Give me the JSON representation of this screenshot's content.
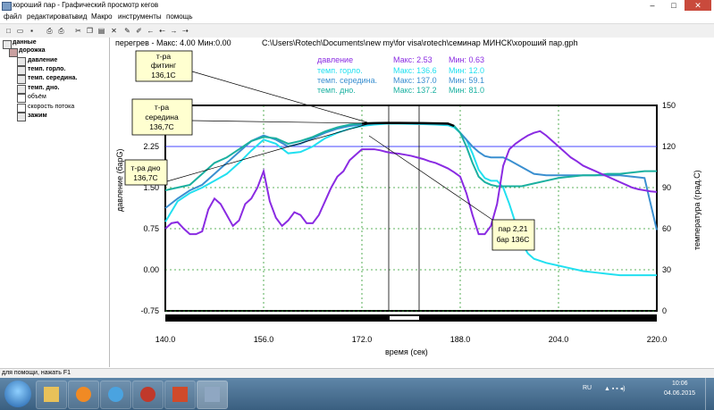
{
  "window": {
    "title": "хороший пар - Графический просмотр кегов",
    "min": "–",
    "max": "□",
    "close": "✕"
  },
  "menu": [
    "файл",
    "редактировать",
    "вид",
    "Макро",
    "инструменты",
    "помощь"
  ],
  "toolbar_icons": [
    "new-icon",
    "open-icon",
    "save-icon",
    "print-preview-icon",
    "print-icon",
    "cut-icon",
    "copy-icon",
    "paste-icon",
    "delete-icon",
    "edit-icon",
    "pen-icon",
    "arrow-left-icon",
    "arrow-left2-icon",
    "arrow-right-icon",
    "arrow-right2-icon"
  ],
  "tree": {
    "root": "данные",
    "track": "дорожка",
    "items": [
      "давление",
      "темп. горло.",
      "темп. середина.",
      "темп. дно.",
      "объём",
      "скорость потока",
      "зажим"
    ]
  },
  "chart_header": {
    "overheat": "перегрев - Макс: 4.00  Мин:0.00",
    "path": "C:\\Users\\Rotech\\Documents\\new my\\for visa\\rotech\\семинар МИНСК\\хороший пар.gph"
  },
  "stats": [
    {
      "name": "давление",
      "max": "Макс: 2.53",
      "min": "Мин: 0.63",
      "color": "#8a2be2"
    },
    {
      "name": "темп. горло.",
      "max": "Макс: 136.6",
      "min": "Мин: 12.0",
      "color": "#22e0f0"
    },
    {
      "name": "темп. середина.",
      "max": "Макс: 137.0",
      "min": "Мин: 59.1",
      "color": "#3a8fd0"
    },
    {
      "name": "темп. дно.",
      "max": "Макс: 137.2",
      "min": "Мин: 81.0",
      "color": "#1ab0a0"
    }
  ],
  "annotations": [
    {
      "lines": [
        "т-ра",
        "фитинг",
        "136,1С"
      ]
    },
    {
      "lines": [
        "т-ра",
        "середина",
        "136,7С"
      ]
    },
    {
      "lines": [
        "т-ра дно",
        "136,7С"
      ]
    },
    {
      "lines": [
        "пар 2,21",
        "бар 136С"
      ]
    }
  ],
  "chart_data": {
    "type": "line",
    "xlabel": "время (сек)",
    "ylabel": "давление (барG)",
    "y2label": "температура (град.C)",
    "xlim": [
      140,
      220
    ],
    "ylim": [
      -0.75,
      3.0
    ],
    "y2lim": [
      0,
      150
    ],
    "xticks": [
      "140.0",
      "156.0",
      "172.0",
      "188.0",
      "204.0",
      "220.0"
    ],
    "yticks": [
      "-0.75",
      "0.00",
      "0.75",
      "1.50",
      "2.25"
    ],
    "y2ticks": [
      "0",
      "30",
      "60",
      "90",
      "120",
      "150"
    ],
    "hline": 2.25,
    "series": [
      {
        "name": "давление",
        "color": "#8a2be2",
        "axis": "left",
        "x": [
          140,
          141,
          142,
          143,
          144,
          145,
          146,
          147,
          148,
          149,
          150,
          151,
          152,
          153,
          154,
          155,
          156,
          157,
          158,
          159,
          160,
          161,
          162,
          163,
          164,
          165,
          166,
          167,
          168,
          169,
          170,
          171,
          172,
          173,
          174,
          175,
          176,
          177,
          178,
          179,
          180,
          181,
          182,
          183,
          184,
          185,
          186,
          187,
          188,
          189,
          190,
          191,
          192,
          193,
          194,
          195,
          196,
          197,
          198,
          199,
          200,
          201,
          202,
          203,
          204,
          205,
          206,
          207,
          208,
          209,
          210,
          211,
          212,
          213,
          214,
          215,
          216,
          217,
          218,
          219,
          220
        ],
        "y": [
          0.75,
          0.85,
          0.87,
          0.75,
          0.65,
          0.65,
          0.7,
          1.1,
          1.3,
          1.2,
          1.0,
          0.8,
          0.9,
          1.2,
          1.3,
          1.5,
          1.8,
          1.25,
          0.95,
          0.8,
          0.9,
          1.05,
          1.0,
          0.85,
          0.85,
          1.0,
          1.25,
          1.5,
          1.7,
          1.8,
          2.0,
          2.1,
          2.2,
          2.2,
          2.2,
          2.18,
          2.15,
          2.13,
          2.12,
          2.1,
          2.08,
          2.05,
          2.02,
          1.98,
          1.95,
          1.9,
          1.85,
          1.78,
          1.7,
          1.4,
          1.0,
          0.65,
          0.65,
          0.8,
          1.2,
          1.9,
          2.2,
          2.3,
          2.38,
          2.45,
          2.5,
          2.53,
          2.45,
          2.35,
          2.25,
          2.15,
          2.05,
          1.98,
          1.9,
          1.85,
          1.8,
          1.75,
          1.7,
          1.65,
          1.6,
          1.55,
          1.5,
          1.47,
          1.45,
          1.43,
          1.42
        ]
      },
      {
        "name": "темп. горло.",
        "color": "#22e0f0",
        "axis": "right",
        "x": [
          140,
          142,
          144,
          146,
          148,
          150,
          152,
          154,
          156,
          158,
          160,
          162,
          164,
          166,
          168,
          170,
          172,
          174,
          176,
          178,
          180,
          182,
          184,
          186,
          187,
          188,
          189,
          190,
          191,
          192,
          193,
          194,
          195,
          196,
          197,
          198,
          199,
          200,
          202,
          204,
          206,
          208,
          210,
          212,
          214,
          216,
          218,
          220
        ],
        "y": [
          65,
          80,
          86,
          90,
          95,
          100,
          108,
          117,
          125,
          122,
          115,
          116,
          120,
          126,
          130,
          133,
          135,
          136,
          136.6,
          136.6,
          136.5,
          136.3,
          136,
          135.5,
          134,
          130,
          125,
          115,
          103,
          97,
          95,
          95,
          90,
          78,
          64,
          50,
          42,
          38,
          35,
          33,
          31,
          29,
          28,
          27,
          26,
          26,
          26,
          26
        ]
      },
      {
        "name": "темп. середина.",
        "color": "#3a8fd0",
        "axis": "right",
        "x": [
          140,
          142,
          144,
          146,
          148,
          150,
          152,
          154,
          156,
          158,
          160,
          162,
          164,
          166,
          168,
          170,
          172,
          174,
          176,
          178,
          180,
          182,
          184,
          186,
          187,
          188,
          189,
          190,
          191,
          192,
          193,
          194,
          195,
          196,
          198,
          200,
          202,
          204,
          206,
          208,
          210,
          212,
          214,
          216,
          218,
          220
        ],
        "y": [
          75,
          82,
          88,
          92,
          100,
          108,
          116,
          124,
          128,
          125,
          120,
          122,
          126,
          130,
          133,
          135,
          136,
          136.8,
          137,
          137,
          136.9,
          136.8,
          136.6,
          136.4,
          135,
          130,
          125,
          120,
          116,
          113,
          112,
          112,
          112,
          110,
          105,
          100,
          99,
          99,
          99,
          99,
          99,
          99,
          99,
          98,
          97,
          59
        ]
      },
      {
        "name": "темп. дно.",
        "color": "#1ab0a0",
        "axis": "right",
        "x": [
          140,
          142,
          144,
          146,
          148,
          150,
          152,
          154,
          156,
          158,
          160,
          162,
          164,
          166,
          168,
          170,
          172,
          174,
          176,
          178,
          180,
          182,
          184,
          186,
          187,
          188,
          189,
          190,
          191,
          192,
          193,
          194,
          195,
          196,
          198,
          200,
          202,
          204,
          206,
          208,
          210,
          212,
          214,
          216,
          218,
          220
        ],
        "y": [
          88,
          90,
          92,
          100,
          108,
          112,
          118,
          124,
          127,
          126,
          122,
          124,
          127,
          131,
          134,
          136,
          136.8,
          137,
          137.2,
          137.2,
          137.1,
          137,
          136.9,
          136.7,
          135,
          130,
          120,
          108,
          98,
          94,
          92,
          91,
          91,
          91,
          91,
          93,
          95,
          97,
          98,
          99,
          99,
          100,
          100,
          101,
          102,
          102
        ]
      }
    ]
  },
  "status": "для помощи, нажать F1",
  "taskbar": {
    "lang": "RU",
    "time": "10:06",
    "date": "04.06.2015"
  }
}
